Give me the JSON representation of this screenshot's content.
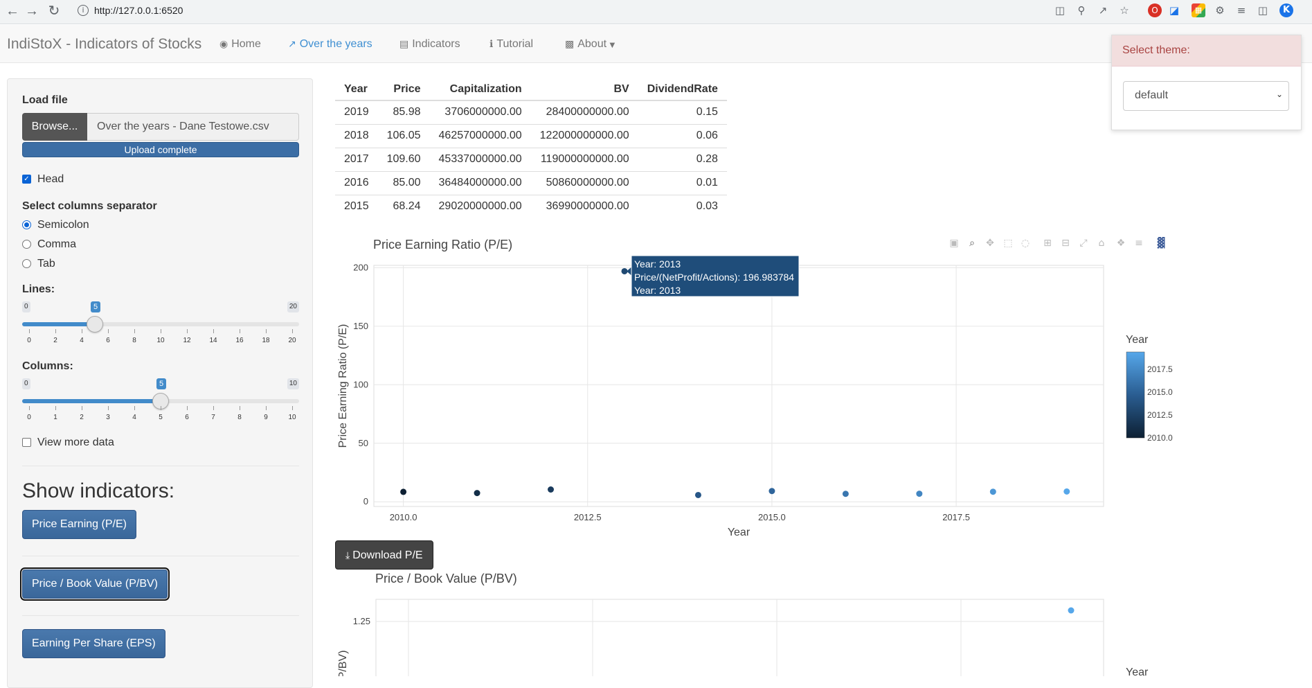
{
  "browser": {
    "url": "http://127.0.0.1:6520",
    "profile_initial": "K"
  },
  "navbar": {
    "brand": "IndiStoX - Indicators of Stocks",
    "items": [
      {
        "label": "Home",
        "icon": "globe-icon"
      },
      {
        "label": "Over the years",
        "icon": "line-chart-icon",
        "active": true
      },
      {
        "label": "Indicators",
        "icon": "book-icon"
      },
      {
        "label": "Tutorial",
        "icon": "info-icon"
      },
      {
        "label": "About",
        "icon": "id-card-icon",
        "dropdown": true
      }
    ]
  },
  "theme_panel": {
    "title": "Select theme:",
    "selected": "default"
  },
  "sidebar": {
    "load_file_label": "Load file",
    "browse_label": "Browse...",
    "file_name": "Over the years - Dane Testowe.csv",
    "upload_status": "Upload complete",
    "head_label": "Head",
    "head_checked": true,
    "separator_label": "Select columns separator",
    "separator_options": [
      "Semicolon",
      "Comma",
      "Tab"
    ],
    "separator_selected": "Semicolon",
    "lines_slider": {
      "label": "Lines:",
      "min": "0",
      "max": "20",
      "value": "5",
      "ticks": [
        "0",
        "2",
        "4",
        "6",
        "8",
        "10",
        "12",
        "14",
        "16",
        "18",
        "20"
      ]
    },
    "columns_slider": {
      "label": "Columns:",
      "min": "0",
      "max": "10",
      "value": "5",
      "ticks": [
        "0",
        "1",
        "2",
        "3",
        "4",
        "5",
        "6",
        "7",
        "8",
        "9",
        "10"
      ]
    },
    "view_more_label": "View more data",
    "view_more_checked": false,
    "show_indicators_title": "Show indicators:",
    "indicator_buttons": [
      "Price Earning (P/E)",
      "Price / Book Value (P/BV)",
      "Earning Per Share (EPS)"
    ]
  },
  "table": {
    "headers": [
      "Year",
      "Price",
      "Capitalization",
      "BV",
      "DividendRate"
    ],
    "rows": [
      [
        "2019",
        "85.98",
        "3706000000.00",
        "28400000000.00",
        "0.15"
      ],
      [
        "2018",
        "106.05",
        "46257000000.00",
        "122000000000.00",
        "0.06"
      ],
      [
        "2017",
        "109.60",
        "45337000000.00",
        "119000000000.00",
        "0.28"
      ],
      [
        "2016",
        "85.00",
        "36484000000.00",
        "50860000000.00",
        "0.01"
      ],
      [
        "2015",
        "68.24",
        "29020000000.00",
        "36990000000.00",
        "0.03"
      ]
    ]
  },
  "plot_toolbar": [
    "camera-icon",
    "zoom-icon",
    "pan-icon",
    "box-select-icon",
    "lasso-icon",
    "zoom-in-icon",
    "zoom-out-icon",
    "autoscale-icon",
    "reset-axes-icon",
    "spike-lines-icon",
    "compare-hover-icon",
    "plotly-logo-icon"
  ],
  "download_pe_label": "Download P/E",
  "chart_data": [
    {
      "type": "scatter",
      "title": "Price Earning Ratio (P/E)",
      "xlabel": "Year",
      "ylabel": "Price Earning Ratio (P/E)",
      "xlim": [
        2009.6,
        2019.5
      ],
      "ylim": [
        -4,
        202
      ],
      "x_ticks": [
        "2010.0",
        "2012.5",
        "2015.0",
        "2017.5"
      ],
      "y_ticks": [
        "0",
        "50",
        "100",
        "150",
        "200"
      ],
      "x": [
        2010,
        2011,
        2012,
        2013,
        2014,
        2015,
        2016,
        2017,
        2018,
        2019
      ],
      "y": [
        8.5,
        7.5,
        10.5,
        196.983784,
        5.8,
        9.2,
        6.8,
        6.9,
        8.6,
        8.8
      ],
      "colorbar": {
        "title": "Year",
        "ticks": [
          "2017.5",
          "2015.0",
          "2012.5",
          "2010.0"
        ],
        "range": [
          2010,
          2019
        ]
      },
      "tooltip": [
        "Year: 2013",
        "Price/(NetProfit/Actions): 196.983784",
        "Year: 2013"
      ]
    },
    {
      "type": "scatter",
      "title": "Price / Book Value (P/BV)",
      "ylabel": "(P/BV)",
      "legend_title": "Year",
      "y_ticks": [
        "1.25"
      ],
      "x": [
        2019
      ],
      "y": [
        1.28
      ]
    }
  ]
}
